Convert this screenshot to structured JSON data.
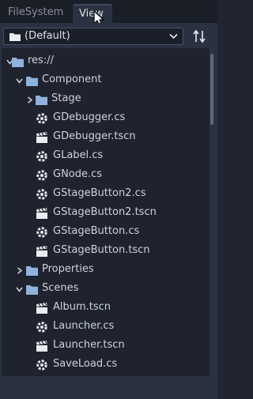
{
  "tabs": [
    {
      "label": "FileSystem",
      "active": false
    },
    {
      "label": "View",
      "active": true
    }
  ],
  "path_dropdown": {
    "value": "(Default)"
  },
  "tree": {
    "rows": [
      {
        "label": "res://",
        "type": "folder",
        "depth": 0,
        "expanded": true
      },
      {
        "label": "Component",
        "type": "folder",
        "depth": 1,
        "expanded": true
      },
      {
        "label": "Stage",
        "type": "folder",
        "depth": 2,
        "expanded": false
      },
      {
        "label": "GDebugger.cs",
        "type": "script",
        "depth": 2
      },
      {
        "label": "GDebugger.tscn",
        "type": "scene",
        "depth": 2
      },
      {
        "label": "GLabel.cs",
        "type": "script",
        "depth": 2
      },
      {
        "label": "GNode.cs",
        "type": "script",
        "depth": 2
      },
      {
        "label": "GStageButton2.cs",
        "type": "script",
        "depth": 2
      },
      {
        "label": "GStageButton2.tscn",
        "type": "scene",
        "depth": 2
      },
      {
        "label": "GStageButton.cs",
        "type": "script",
        "depth": 2
      },
      {
        "label": "GStageButton.tscn",
        "type": "scene",
        "depth": 2
      },
      {
        "label": "Properties",
        "type": "folder",
        "depth": 1,
        "expanded": false
      },
      {
        "label": "Scenes",
        "type": "folder",
        "depth": 1,
        "expanded": true
      },
      {
        "label": "Album.tscn",
        "type": "scene",
        "depth": 2
      },
      {
        "label": "Launcher.cs",
        "type": "script",
        "depth": 2
      },
      {
        "label": "Launcher.tscn",
        "type": "scene",
        "depth": 2
      },
      {
        "label": "SaveLoad.cs",
        "type": "script",
        "depth": 2
      }
    ]
  },
  "colors": {
    "folder": "#8fb3dc",
    "filter_green": "#6fd88a",
    "filter_red": "#e8596d",
    "accent": "#7aa7e0"
  },
  "icons": {
    "folder": "folder-icon",
    "script": "csharp-script-icon",
    "scene": "clapperboard-scene-icon",
    "sort": "sort-options-icon",
    "list": "list-view-icon",
    "tree": "tree-view-icon"
  }
}
